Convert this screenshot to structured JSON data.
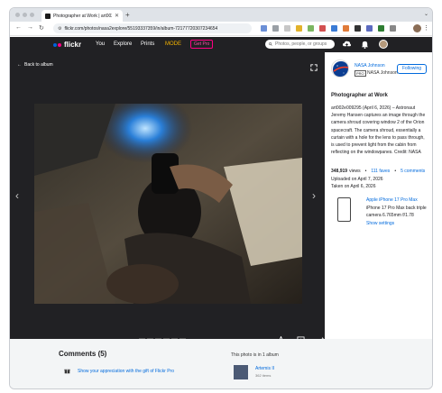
{
  "browser": {
    "tab_title": "Photographer at Work | art002e",
    "url": "flickr.com/photos/nasa2explore/55193337359/in/album-72177720307234654"
  },
  "header": {
    "logo_text": "flickr",
    "nav": [
      "You",
      "Explore",
      "Prints",
      "MODE"
    ],
    "get_pro": "Get Pro",
    "search_placeholder": "Photos, people, or groups",
    "colors": {
      "header_bg": "#212124",
      "blue_dot": "#0063dc",
      "pink_dot": "#ff0084",
      "mode": "#f5b400"
    }
  },
  "stage": {
    "back_label": "Back to album"
  },
  "owner": {
    "name": "NASA Johnson",
    "pro_badge": "PRO",
    "subtitle": "NASA Johnson",
    "follow_label": "Following"
  },
  "photo": {
    "title": "Photographer at Work",
    "description": "art002e009295 (April 6, 2026) – Astronaut Jeremy Hansen captures an image through the camera shroud covering window 2 of the Orion spacecraft. The camera shroud, essentially a curtain with a hole for the lens to pass through, is used to prevent light from the cabin from reflecting on the windowpanes. Credit: NASA",
    "views_value": "348,919",
    "views_label": "views",
    "faves": "111 faves",
    "comments": "5 comments",
    "uploaded": "Uploaded on April 7, 2026",
    "taken": "Taken on April 6, 2026"
  },
  "camera": {
    "name": "Apple iPhone 17 Pro Max",
    "line1": "iPhone 17 Pro Max back triple",
    "line2": "camera 6.765mm f/1.78",
    "settings": "Show settings"
  },
  "comments": {
    "heading": "Comments (5)",
    "gift": "Show your appreciation with the gift of Flickr Pro"
  },
  "albums": {
    "heading": "This photo is in 1 album",
    "name": "Artemis II",
    "count": "362 items"
  }
}
